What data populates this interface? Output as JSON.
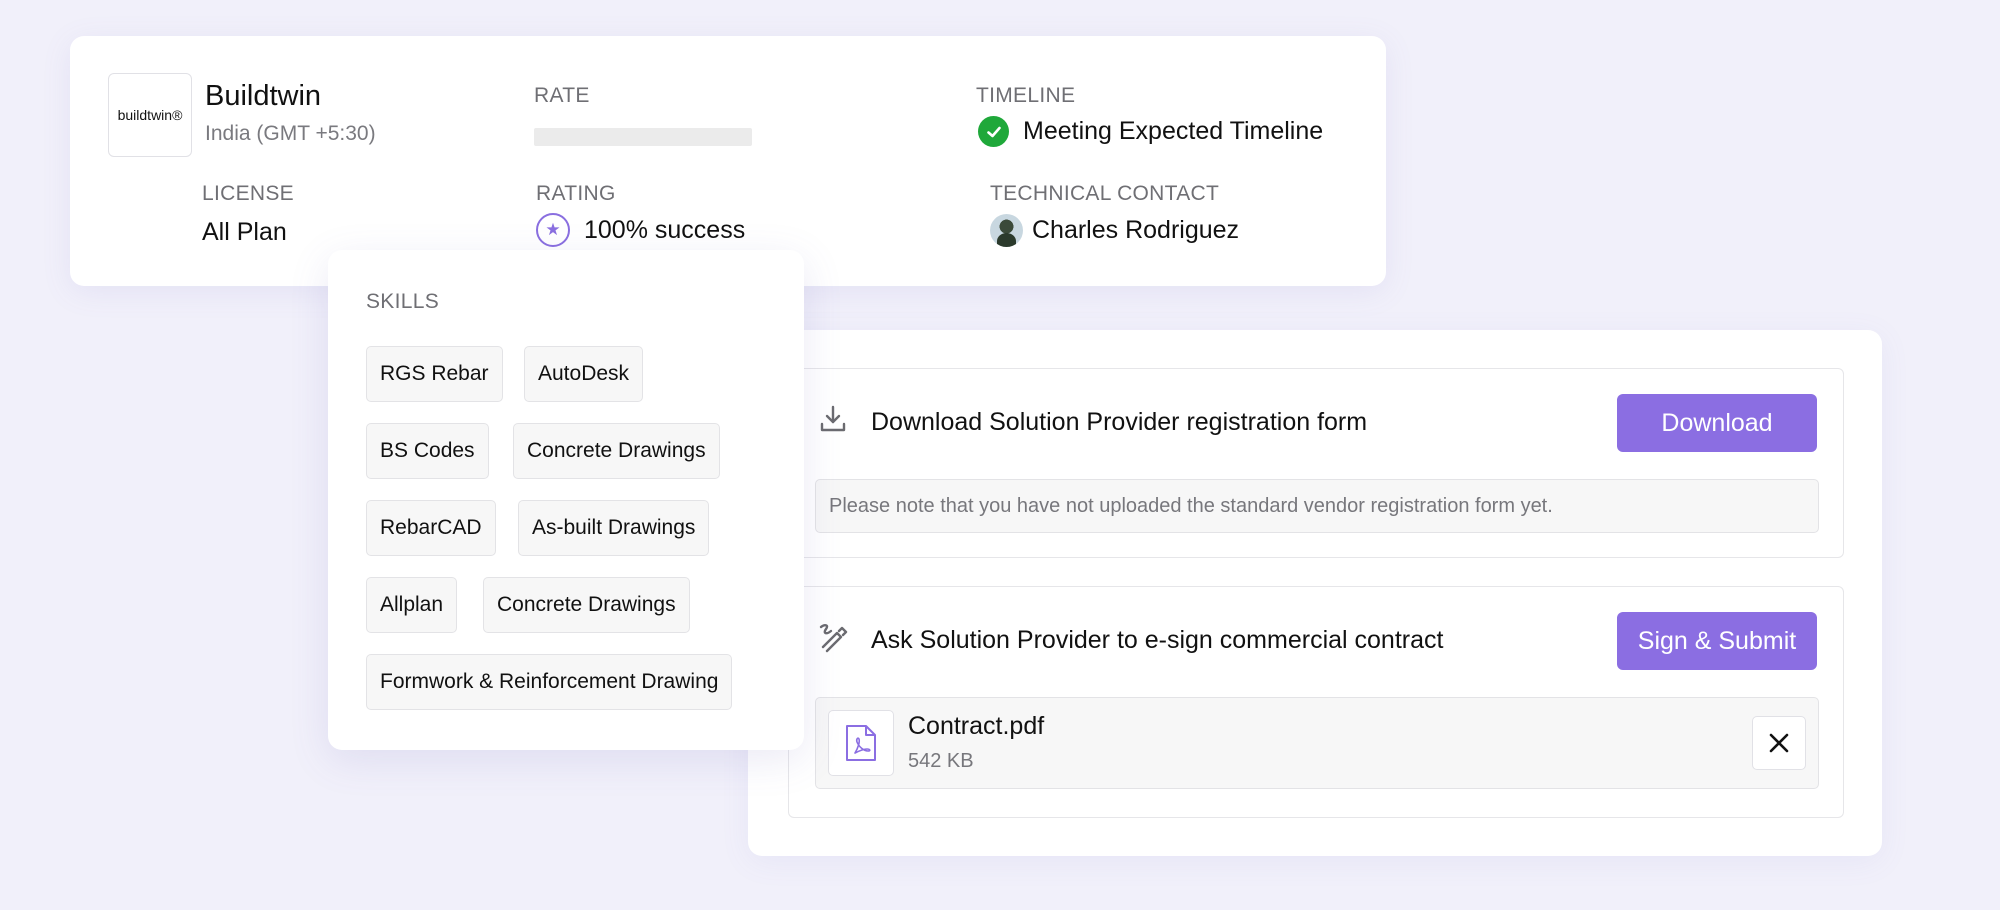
{
  "vendor": {
    "logo_text": "buildtwin®",
    "name": "Buildtwin",
    "timezone": "India (GMT +5:30)",
    "rate_label": "RATE",
    "timeline_label": "TIMELINE",
    "timeline_value": "Meeting Expected Timeline",
    "license_label": "LICENSE",
    "license_value": "All Plan",
    "rating_label": "RATING",
    "rating_value": "100% success",
    "contact_label": "TECHNICAL CONTACT",
    "contact_value": "Charles Rodriguez",
    "icons": [
      "check-circle-icon",
      "star-icon",
      "avatar"
    ],
    "colors": {
      "success": "#1fa83a",
      "accent": "#8b6ee2"
    }
  },
  "skills": {
    "title": "SKILLS",
    "items": [
      "RGS Rebar",
      "AutoDesk",
      "BS Codes",
      "Concrete Drawings",
      "RebarCAD",
      "As-built Drawings",
      "Allplan",
      "Concrete Drawings",
      "Formwork & Reinforcement Drawing"
    ]
  },
  "actions": {
    "download": {
      "text": "Download Solution Provider registration form",
      "button": "Download",
      "note": "Please note that you have not uploaded the standard vendor registration form yet.",
      "icon": "download-icon"
    },
    "esign": {
      "text": "Ask Solution Provider to e-sign commercial contract",
      "button": "Sign & Submit",
      "icon": "signature-icon",
      "file": {
        "name": "Contract.pdf",
        "size": "542 KB",
        "icon": "pdf-file-icon"
      }
    }
  }
}
